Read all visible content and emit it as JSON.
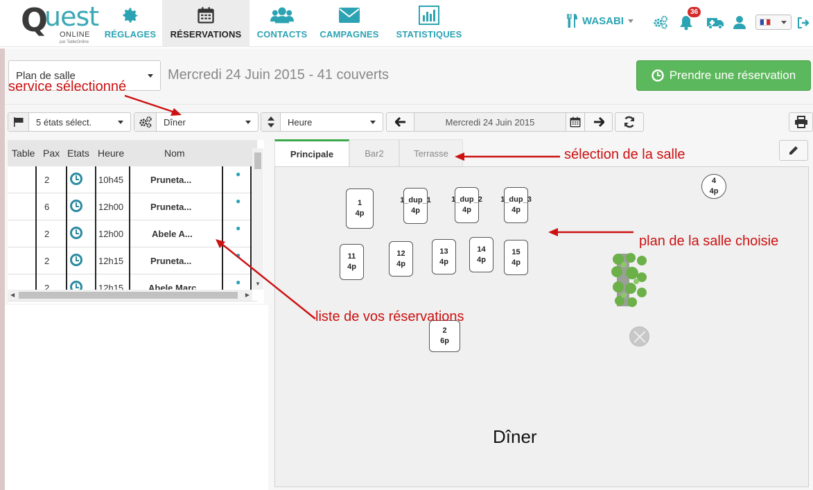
{
  "logo": {
    "q": "Q",
    "uest": "uest",
    "online": "ONLINE",
    "par": "par TableOnline"
  },
  "nav": [
    {
      "label": "RÉGLAGES",
      "icon": "gear-icon"
    },
    {
      "label": "RÉSERVATIONS",
      "icon": "calendar-icon"
    },
    {
      "label": "CONTACTS",
      "icon": "users-icon"
    },
    {
      "label": "CAMPAGNES",
      "icon": "envelope-icon"
    },
    {
      "label": "STATISTIQUES",
      "icon": "chart-icon"
    }
  ],
  "user": {
    "restaurant": "WASABI",
    "notifications": "36"
  },
  "colors": {
    "accent": "#2ba3b3",
    "green": "#5cb85c",
    "annotation": "#cc1111"
  },
  "view_select": "Plan de salle",
  "page_date": "Mercredi 24 Juin 2015 - 41 couverts",
  "new_reservation": "Prendre une réservation",
  "toolbar": {
    "states": "5 états sélect.",
    "service": "Dîner",
    "sort": "Heure",
    "date": "Mercredi 24 Juin 2015"
  },
  "list": {
    "headers": {
      "table": "Table",
      "pax": "Pax",
      "etats": "Etats",
      "heure": "Heure",
      "nom": "Nom"
    },
    "rows": [
      {
        "pax": "2",
        "heure": "10h45",
        "nom": "Pruneta..."
      },
      {
        "pax": "6",
        "heure": "12h00",
        "nom": "Pruneta..."
      },
      {
        "pax": "2",
        "heure": "12h00",
        "nom": "Abele A..."
      },
      {
        "pax": "2",
        "heure": "12h15",
        "nom": "Pruneta..."
      },
      {
        "pax": "2",
        "heure": "12h15",
        "nom": "Abele Marc"
      }
    ]
  },
  "rooms": [
    "Principale",
    "Bar2",
    "Terrasse"
  ],
  "tables": [
    {
      "name": "1",
      "seats": "4p"
    },
    {
      "name": "1_dup_1",
      "seats": "4p"
    },
    {
      "name": "1_dup_2",
      "seats": "4p"
    },
    {
      "name": "1_dup_3",
      "seats": "4p"
    },
    {
      "name": "4",
      "seats": "4p"
    },
    {
      "name": "11",
      "seats": "4p"
    },
    {
      "name": "12",
      "seats": "4p"
    },
    {
      "name": "13",
      "seats": "4p"
    },
    {
      "name": "14",
      "seats": "4p"
    },
    {
      "name": "15",
      "seats": "4p"
    },
    {
      "name": "2",
      "seats": "6p"
    }
  ],
  "service_label": "Dîner",
  "annotations": {
    "service": "service sélectionné",
    "room": "sélection de la salle",
    "plan": "plan de la salle choisie",
    "list": "liste de vos réservations"
  }
}
